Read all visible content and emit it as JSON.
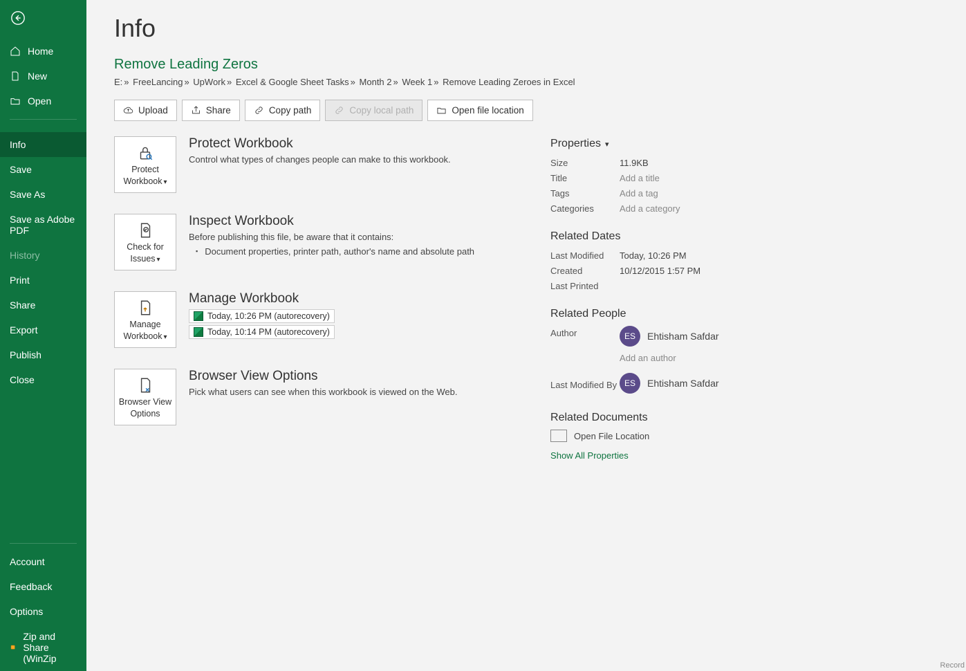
{
  "sidebar": {
    "top": [
      {
        "label": "Home",
        "icon": "home"
      },
      {
        "label": "New",
        "icon": "new"
      },
      {
        "label": "Open",
        "icon": "open"
      }
    ],
    "mid": [
      {
        "label": "Info",
        "active": true
      },
      {
        "label": "Save"
      },
      {
        "label": "Save As"
      },
      {
        "label": "Save as Adobe PDF"
      },
      {
        "label": "History",
        "disabled": true
      },
      {
        "label": "Print"
      },
      {
        "label": "Share"
      },
      {
        "label": "Export"
      },
      {
        "label": "Publish"
      },
      {
        "label": "Close"
      }
    ],
    "bottom": [
      {
        "label": "Account"
      },
      {
        "label": "Feedback"
      },
      {
        "label": "Options"
      },
      {
        "label": "Zip and Share (WinZip",
        "icon": "zip"
      }
    ]
  },
  "page": {
    "title": "Info",
    "docTitle": "Remove Leading Zeros"
  },
  "breadcrumbs": [
    "E:",
    "FreeLancing",
    "UpWork",
    "Excel & Google Sheet Tasks",
    "Month 2",
    "Week 1",
    "Remove Leading Zeroes in Excel"
  ],
  "actions": {
    "upload": "Upload",
    "share": "Share",
    "copyPath": "Copy path",
    "copyLocal": "Copy local path",
    "openLoc": "Open file location"
  },
  "cards": {
    "protect": {
      "btn1": "Protect",
      "btn2": "Workbook",
      "title": "Protect Workbook",
      "desc": "Control what types of changes people can make to this workbook."
    },
    "inspect": {
      "btn1": "Check for",
      "btn2": "Issues",
      "title": "Inspect Workbook",
      "desc": "Before publishing this file, be aware that it contains:",
      "bullet": "Document properties, printer path, author's name and absolute path"
    },
    "manage": {
      "btn1": "Manage",
      "btn2": "Workbook",
      "title": "Manage Workbook",
      "rec1": "Today, 10:26 PM (autorecovery)",
      "rec2": "Today, 10:14 PM (autorecovery)"
    },
    "browser": {
      "btn1": "Browser View",
      "btn2": "Options",
      "title": "Browser View Options",
      "desc": "Pick what users can see when this workbook is viewed on the Web."
    }
  },
  "props": {
    "heading": "Properties",
    "size": {
      "k": "Size",
      "v": "11.9KB"
    },
    "title": {
      "k": "Title",
      "v": "Add a title"
    },
    "tags": {
      "k": "Tags",
      "v": "Add a tag"
    },
    "cat": {
      "k": "Categories",
      "v": "Add a category"
    },
    "datesHeading": "Related Dates",
    "lastMod": {
      "k": "Last Modified",
      "v": "Today, 10:26 PM"
    },
    "created": {
      "k": "Created",
      "v": "10/12/2015 1:57 PM"
    },
    "lastPrint": {
      "k": "Last Printed",
      "v": ""
    },
    "peopleHeading": "Related People",
    "authorK": "Author",
    "authorInit": "ES",
    "authorName": "Ehtisham Safdar",
    "addAuthor": "Add an author",
    "lmbK": "Last Modified By",
    "lmbInit": "ES",
    "lmbName": "Ehtisham Safdar",
    "docsHeading": "Related Documents",
    "openFile": "Open File Location",
    "showAll": "Show All Properties"
  },
  "footer": {
    "record": "Record"
  }
}
